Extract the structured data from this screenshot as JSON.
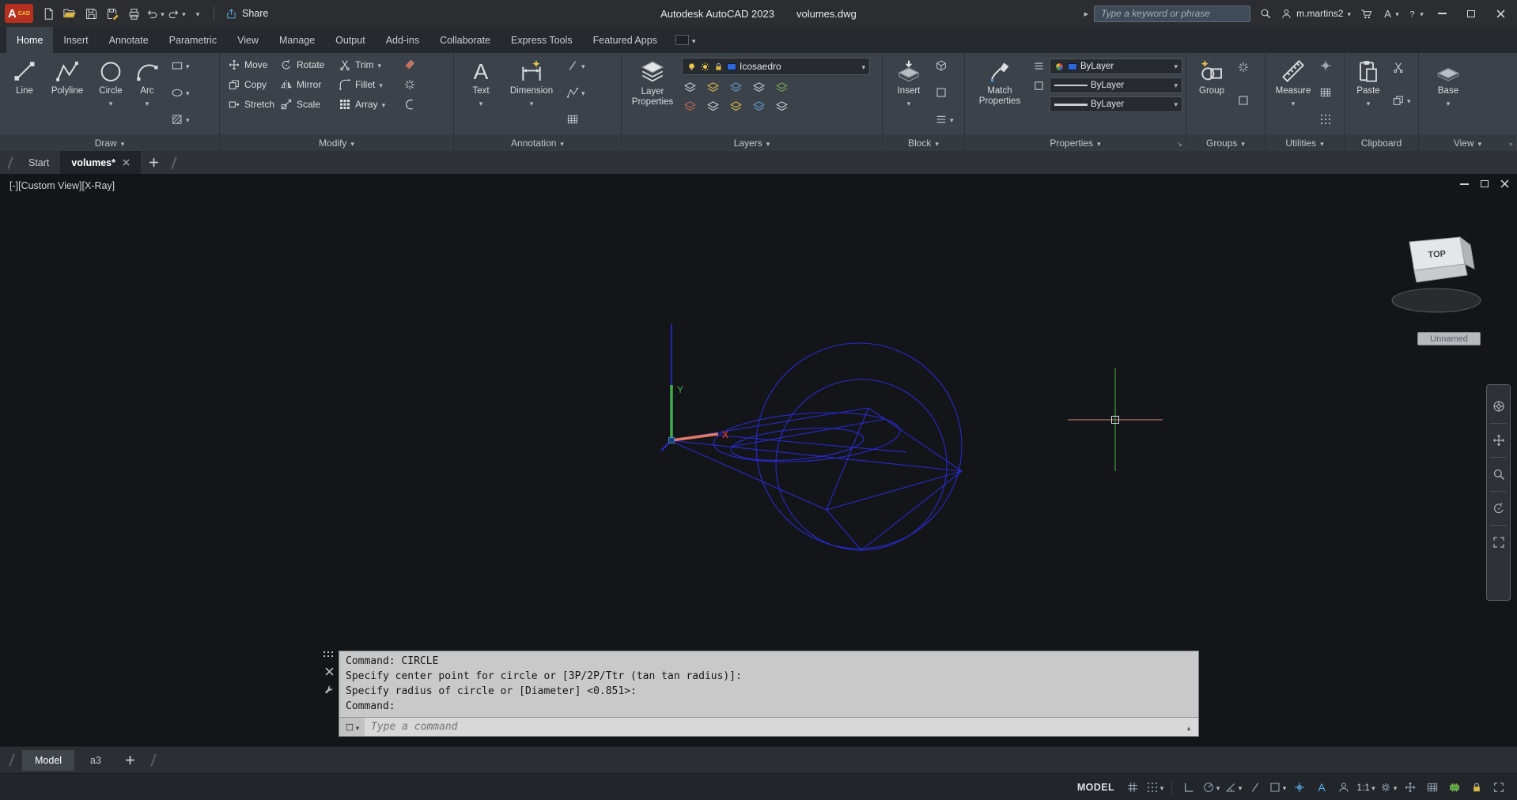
{
  "titlebar": {
    "logo": "A",
    "logo_sub": "CAD",
    "share": "Share",
    "app_title": "Autodesk AutoCAD 2023",
    "doc_title": "volumes.dwg",
    "search_placeholder": "Type a keyword or phrase",
    "user": "m.martins2"
  },
  "ribbon_tabs": [
    "Home",
    "Insert",
    "Annotate",
    "Parametric",
    "View",
    "Manage",
    "Output",
    "Add-ins",
    "Collaborate",
    "Express Tools",
    "Featured Apps"
  ],
  "panels": {
    "draw": {
      "label": "Draw",
      "line": "Line",
      "polyline": "Polyline",
      "circle": "Circle",
      "arc": "Arc"
    },
    "modify": {
      "label": "Modify",
      "move": "Move",
      "rotate": "Rotate",
      "trim": "Trim",
      "copy": "Copy",
      "mirror": "Mirror",
      "fillet": "Fillet",
      "stretch": "Stretch",
      "scale": "Scale",
      "array": "Array"
    },
    "annotation": {
      "label": "Annotation",
      "text": "Text",
      "dimension": "Dimension"
    },
    "layers": {
      "label": "Layers",
      "big": "Layer Properties",
      "layer": "Icosaedro"
    },
    "block": {
      "label": "Block",
      "insert": "Insert"
    },
    "properties": {
      "label": "Properties",
      "match": "Match Properties",
      "color": "ByLayer",
      "linetype": "ByLayer",
      "lineweight": "ByLayer"
    },
    "groups": {
      "label": "Groups",
      "group": "Group"
    },
    "utilities": {
      "label": "Utilities",
      "measure": "Measure"
    },
    "clipboard": {
      "label": "Clipboard",
      "paste": "Paste"
    },
    "view": {
      "label": "View",
      "base": "Base"
    }
  },
  "file_tabs": {
    "start": "Start",
    "doc": "volumes*"
  },
  "viewport": {
    "controls": "[-]",
    "view_name": "[Custom View]",
    "visual_style": "[X-Ray]",
    "cube_face": "TOP",
    "view_label": "Unnamed",
    "axis_x": "X",
    "axis_y": "Y"
  },
  "command": {
    "line1": "Command: CIRCLE",
    "line2": "Specify center point for circle or [3P/2P/Ttr (tan tan radius)]:",
    "line3": "Specify radius of circle or [Diameter] <0.851>:",
    "line4": "Command:",
    "placeholder": "Type a command"
  },
  "bottom_tabs": {
    "model": "Model",
    "layout": "a3"
  },
  "statusbar": {
    "model": "MODEL",
    "scale": "1:1"
  }
}
